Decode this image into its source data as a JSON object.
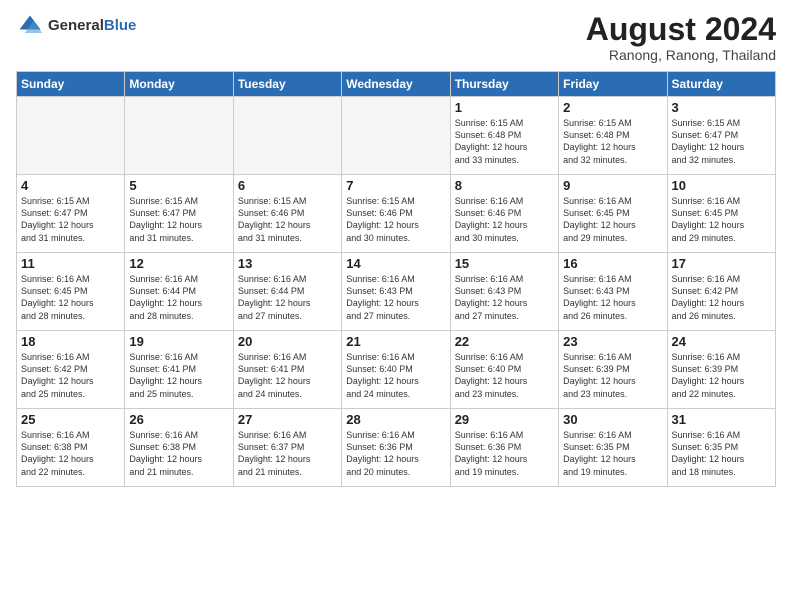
{
  "header": {
    "logo_general": "General",
    "logo_blue": "Blue",
    "month_year": "August 2024",
    "location": "Ranong, Ranong, Thailand"
  },
  "days_of_week": [
    "Sunday",
    "Monday",
    "Tuesday",
    "Wednesday",
    "Thursday",
    "Friday",
    "Saturday"
  ],
  "weeks": [
    [
      {
        "day": "",
        "empty": true
      },
      {
        "day": "",
        "empty": true
      },
      {
        "day": "",
        "empty": true
      },
      {
        "day": "",
        "empty": true
      },
      {
        "day": "1",
        "sunrise": "6:15 AM",
        "sunset": "6:48 PM",
        "daylight": "12 hours and 33 minutes."
      },
      {
        "day": "2",
        "sunrise": "6:15 AM",
        "sunset": "6:48 PM",
        "daylight": "12 hours and 32 minutes."
      },
      {
        "day": "3",
        "sunrise": "6:15 AM",
        "sunset": "6:47 PM",
        "daylight": "12 hours and 32 minutes."
      }
    ],
    [
      {
        "day": "4",
        "sunrise": "6:15 AM",
        "sunset": "6:47 PM",
        "daylight": "12 hours and 31 minutes."
      },
      {
        "day": "5",
        "sunrise": "6:15 AM",
        "sunset": "6:47 PM",
        "daylight": "12 hours and 31 minutes."
      },
      {
        "day": "6",
        "sunrise": "6:15 AM",
        "sunset": "6:46 PM",
        "daylight": "12 hours and 31 minutes."
      },
      {
        "day": "7",
        "sunrise": "6:15 AM",
        "sunset": "6:46 PM",
        "daylight": "12 hours and 30 minutes."
      },
      {
        "day": "8",
        "sunrise": "6:16 AM",
        "sunset": "6:46 PM",
        "daylight": "12 hours and 30 minutes."
      },
      {
        "day": "9",
        "sunrise": "6:16 AM",
        "sunset": "6:45 PM",
        "daylight": "12 hours and 29 minutes."
      },
      {
        "day": "10",
        "sunrise": "6:16 AM",
        "sunset": "6:45 PM",
        "daylight": "12 hours and 29 minutes."
      }
    ],
    [
      {
        "day": "11",
        "sunrise": "6:16 AM",
        "sunset": "6:45 PM",
        "daylight": "12 hours and 28 minutes."
      },
      {
        "day": "12",
        "sunrise": "6:16 AM",
        "sunset": "6:44 PM",
        "daylight": "12 hours and 28 minutes."
      },
      {
        "day": "13",
        "sunrise": "6:16 AM",
        "sunset": "6:44 PM",
        "daylight": "12 hours and 27 minutes."
      },
      {
        "day": "14",
        "sunrise": "6:16 AM",
        "sunset": "6:43 PM",
        "daylight": "12 hours and 27 minutes."
      },
      {
        "day": "15",
        "sunrise": "6:16 AM",
        "sunset": "6:43 PM",
        "daylight": "12 hours and 27 minutes."
      },
      {
        "day": "16",
        "sunrise": "6:16 AM",
        "sunset": "6:43 PM",
        "daylight": "12 hours and 26 minutes."
      },
      {
        "day": "17",
        "sunrise": "6:16 AM",
        "sunset": "6:42 PM",
        "daylight": "12 hours and 26 minutes."
      }
    ],
    [
      {
        "day": "18",
        "sunrise": "6:16 AM",
        "sunset": "6:42 PM",
        "daylight": "12 hours and 25 minutes."
      },
      {
        "day": "19",
        "sunrise": "6:16 AM",
        "sunset": "6:41 PM",
        "daylight": "12 hours and 25 minutes."
      },
      {
        "day": "20",
        "sunrise": "6:16 AM",
        "sunset": "6:41 PM",
        "daylight": "12 hours and 24 minutes."
      },
      {
        "day": "21",
        "sunrise": "6:16 AM",
        "sunset": "6:40 PM",
        "daylight": "12 hours and 24 minutes."
      },
      {
        "day": "22",
        "sunrise": "6:16 AM",
        "sunset": "6:40 PM",
        "daylight": "12 hours and 23 minutes."
      },
      {
        "day": "23",
        "sunrise": "6:16 AM",
        "sunset": "6:39 PM",
        "daylight": "12 hours and 23 minutes."
      },
      {
        "day": "24",
        "sunrise": "6:16 AM",
        "sunset": "6:39 PM",
        "daylight": "12 hours and 22 minutes."
      }
    ],
    [
      {
        "day": "25",
        "sunrise": "6:16 AM",
        "sunset": "6:38 PM",
        "daylight": "12 hours and 22 minutes."
      },
      {
        "day": "26",
        "sunrise": "6:16 AM",
        "sunset": "6:38 PM",
        "daylight": "12 hours and 21 minutes."
      },
      {
        "day": "27",
        "sunrise": "6:16 AM",
        "sunset": "6:37 PM",
        "daylight": "12 hours and 21 minutes."
      },
      {
        "day": "28",
        "sunrise": "6:16 AM",
        "sunset": "6:36 PM",
        "daylight": "12 hours and 20 minutes."
      },
      {
        "day": "29",
        "sunrise": "6:16 AM",
        "sunset": "6:36 PM",
        "daylight": "12 hours and 19 minutes."
      },
      {
        "day": "30",
        "sunrise": "6:16 AM",
        "sunset": "6:35 PM",
        "daylight": "12 hours and 19 minutes."
      },
      {
        "day": "31",
        "sunrise": "6:16 AM",
        "sunset": "6:35 PM",
        "daylight": "12 hours and 18 minutes."
      }
    ]
  ],
  "labels": {
    "sunrise": "Sunrise:",
    "sunset": "Sunset:",
    "daylight": "Daylight:"
  }
}
